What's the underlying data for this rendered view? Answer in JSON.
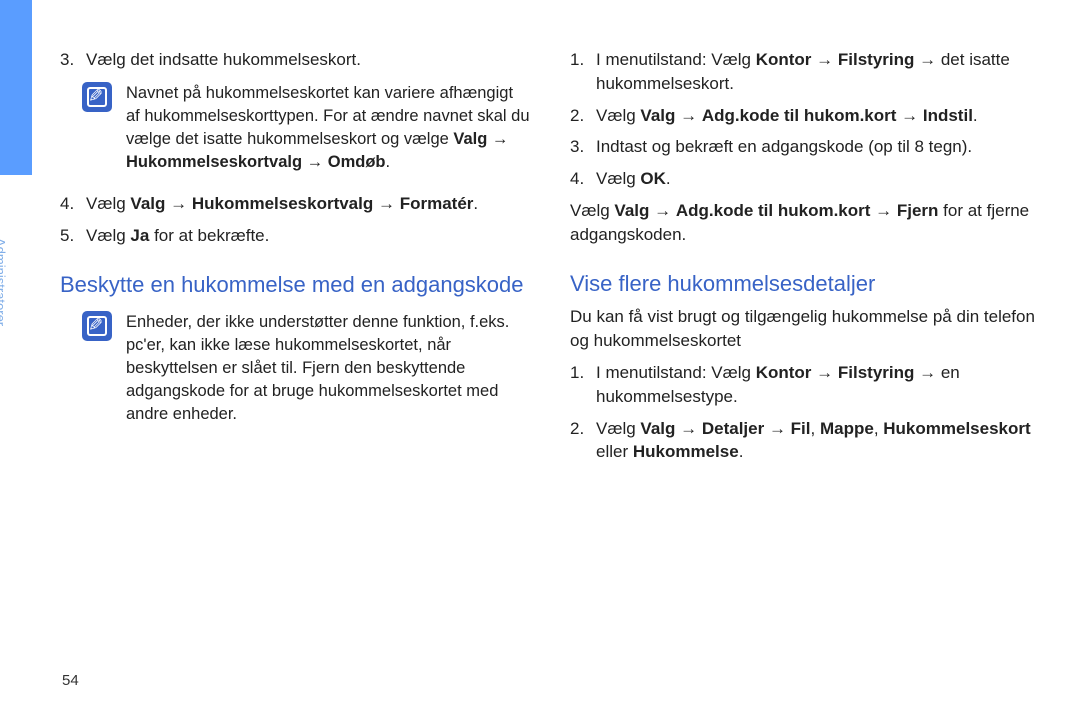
{
  "sidebar": {
    "label": "Administratorer"
  },
  "page_number": "54",
  "left": {
    "step3": {
      "num": "3.",
      "text": "Vælg det indsatte hukommelseskort."
    },
    "note1": {
      "t1": "Navnet på hukommelseskortet kan variere afhængigt af hukommelseskorttypen. For at ændre navnet skal du vælge det isatte hukommelseskort og vælge ",
      "b1": "Valg",
      "arrow1": " → ",
      "b2": "Hukommelseskortvalg",
      "arrow2": " → ",
      "b3": "Omdøb",
      "period": "."
    },
    "step4": {
      "num": "4.",
      "pre": "Vælg ",
      "b1": "Valg",
      "a1": " → ",
      "b2": "Hukommelseskortvalg",
      "a2": " → ",
      "b3": "Formatér",
      "post": "."
    },
    "step5": {
      "num": "5.",
      "pre": "Vælg ",
      "b1": "Ja",
      "post": " for at bekræfte."
    },
    "heading1": "Beskytte en hukommelse med en adgangskode",
    "note2": "Enheder, der ikke understøtter denne funktion, f.eks. pc'er, kan ikke læse hukommelseskortet, når beskyttelsen er slået til. Fjern den beskyttende adgangskode for at bruge hukommelseskortet med andre enheder."
  },
  "right": {
    "step1": {
      "num": "1.",
      "pre": "I menutilstand: Vælg ",
      "b1": "Kontor",
      "a1": " → ",
      "b2": "Filstyring",
      "a2": " → det isatte hukommelseskort."
    },
    "step2": {
      "num": "2.",
      "pre": "Vælg ",
      "b1": "Valg",
      "a1": " → ",
      "b2": "Adg.kode til hukom.kort",
      "a2": " → ",
      "b3": "Indstil",
      "post": "."
    },
    "step3": {
      "num": "3.",
      "text": "Indtast og bekræft en adgangskode (op til 8 tegn)."
    },
    "step4": {
      "num": "4.",
      "pre": "Vælg ",
      "b1": "OK",
      "post": "."
    },
    "para1": {
      "pre": "Vælg ",
      "b1": "Valg",
      "a1": " → ",
      "b2": "Adg.kode til hukom.kort",
      "a2": " → ",
      "b3": "Fjern",
      "post": " for at fjerne adgangskoden."
    },
    "heading2": "Vise flere hukommelsesdetaljer",
    "para2": "Du kan få vist brugt og tilgængelig hukommelse på din telefon og hukommelseskortet",
    "b_step1": {
      "num": "1.",
      "pre": "I menutilstand: Vælg ",
      "b1": "Kontor",
      "a1": " → ",
      "b2": "Filstyring",
      "a2": " → en hukommelsestype."
    },
    "b_step2": {
      "num": "2.",
      "pre": "Vælg ",
      "b1": "Valg",
      "a1": " → ",
      "b2": "Detaljer",
      "a2": " → ",
      "b3": "Fil",
      "mid1": ", ",
      "b4": "Mappe",
      "mid2": ", ",
      "b5": "Hukommelseskort",
      "mid3": " eller ",
      "b6": "Hukommelse",
      "post": "."
    }
  }
}
